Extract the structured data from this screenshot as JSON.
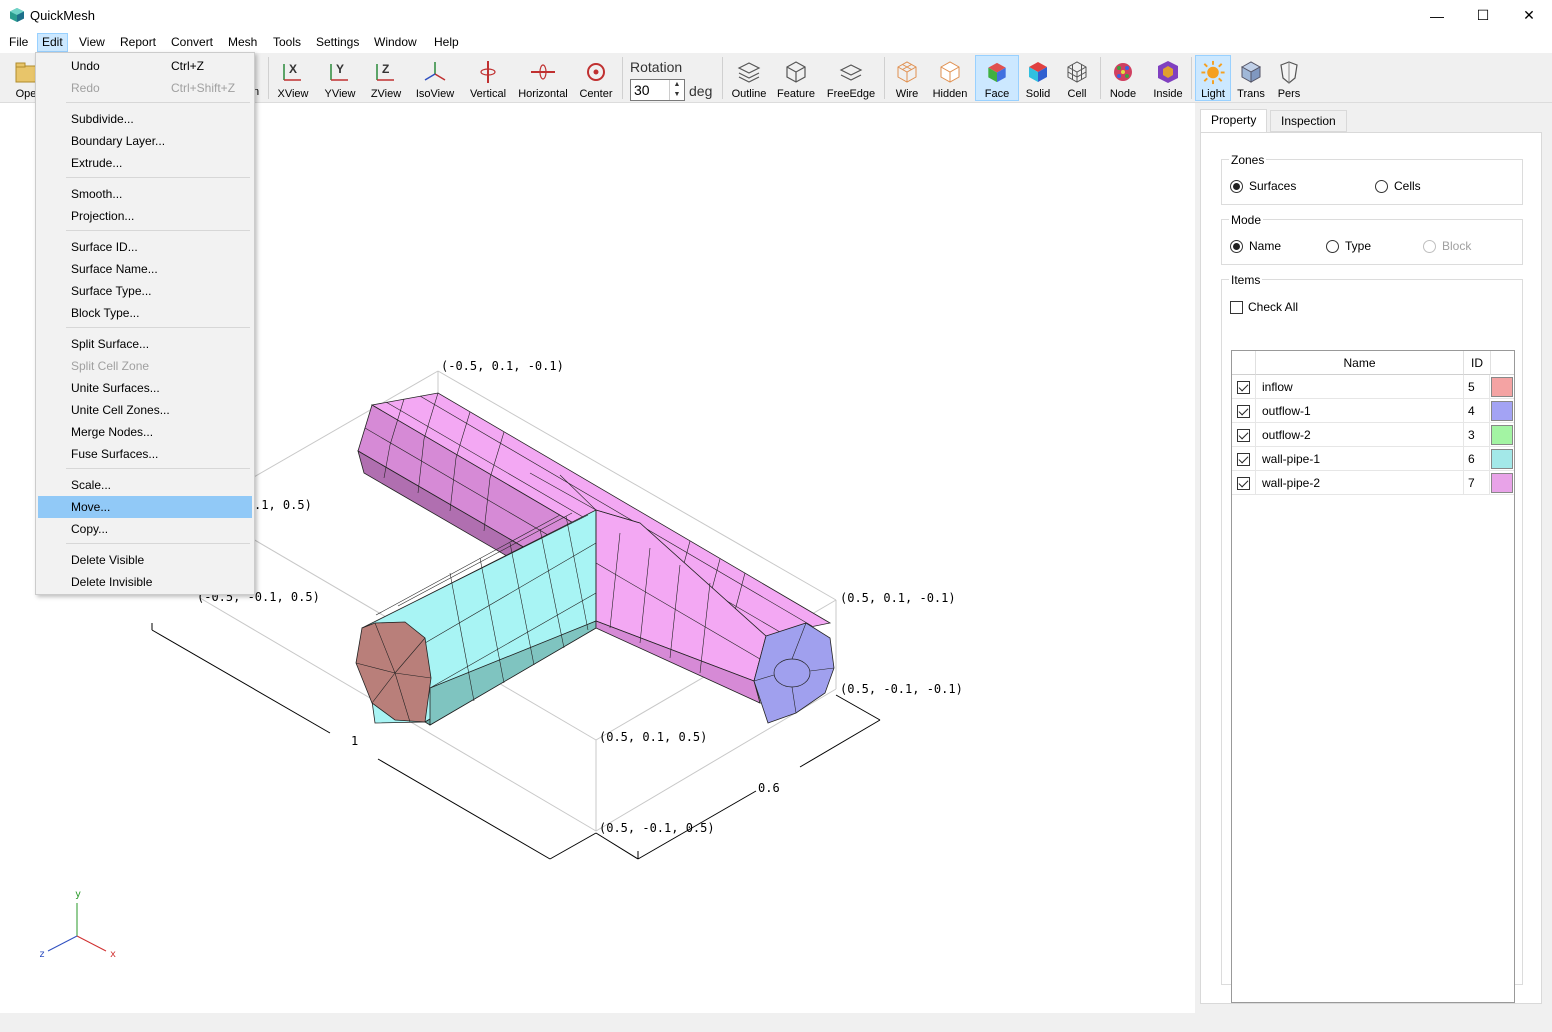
{
  "window": {
    "title": "QuickMesh",
    "minimize_glyph": "—",
    "maximize_glyph": "☐",
    "close_glyph": "✕"
  },
  "menubar": {
    "items": [
      "File",
      "Edit",
      "View",
      "Report",
      "Convert",
      "Mesh",
      "Tools",
      "Settings",
      "Window",
      "Help"
    ],
    "active": "Edit"
  },
  "toolbar": {
    "open_label": "Ope",
    "partial_label": "n",
    "buttons": [
      {
        "label": "XView",
        "icon": "xview-icon"
      },
      {
        "label": "YView",
        "icon": "yview-icon"
      },
      {
        "label": "ZView",
        "icon": "zview-icon"
      },
      {
        "label": "IsoView",
        "icon": "isoview-icon"
      },
      {
        "label": "Vertical",
        "icon": "vertical-rotate-icon"
      },
      {
        "label": "Horizontal",
        "icon": "horizontal-rotate-icon"
      },
      {
        "label": "Center",
        "icon": "center-icon"
      },
      {
        "label": "Outline",
        "icon": "outline-icon"
      },
      {
        "label": "Feature",
        "icon": "feature-icon"
      },
      {
        "label": "FreeEdge",
        "icon": "freeedge-icon"
      },
      {
        "label": "Wire",
        "icon": "wire-icon"
      },
      {
        "label": "Hidden",
        "icon": "hidden-icon"
      },
      {
        "label": "Face",
        "icon": "face-icon",
        "checked": true
      },
      {
        "label": "Solid",
        "icon": "solid-icon"
      },
      {
        "label": "Cell",
        "icon": "cell-icon"
      },
      {
        "label": "Node",
        "icon": "node-icon"
      },
      {
        "label": "Inside",
        "icon": "inside-icon"
      },
      {
        "label": "Light",
        "icon": "light-icon",
        "checked": true
      },
      {
        "label": "Trans",
        "icon": "trans-icon"
      },
      {
        "label": "Pers",
        "icon": "pers-icon"
      }
    ],
    "rotation": {
      "label": "Rotation",
      "value": "30",
      "unit": "deg",
      "spin_up": "▲",
      "spin_down": "▼"
    }
  },
  "edit_menu": {
    "items": [
      {
        "label": "Undo",
        "shortcut": "Ctrl+Z"
      },
      {
        "label": "Redo",
        "shortcut": "Ctrl+Shift+Z",
        "disabled": true
      },
      {
        "sep": true
      },
      {
        "label": "Subdivide..."
      },
      {
        "label": "Boundary Layer..."
      },
      {
        "label": "Extrude..."
      },
      {
        "sep": true
      },
      {
        "label": "Smooth..."
      },
      {
        "label": "Projection..."
      },
      {
        "sep": true
      },
      {
        "label": "Surface ID..."
      },
      {
        "label": "Surface Name..."
      },
      {
        "label": "Surface Type..."
      },
      {
        "label": "Block Type..."
      },
      {
        "sep": true
      },
      {
        "label": "Split Surface..."
      },
      {
        "label": "Split Cell Zone",
        "disabled": true
      },
      {
        "label": "Unite Surfaces..."
      },
      {
        "label": "Unite Cell Zones..."
      },
      {
        "label": "Merge Nodes..."
      },
      {
        "label": "Fuse Surfaces..."
      },
      {
        "sep": true
      },
      {
        "label": "Scale..."
      },
      {
        "label": "Move...",
        "hover": true
      },
      {
        "label": "Copy..."
      },
      {
        "sep": true
      },
      {
        "label": "Delete Visible"
      },
      {
        "label": "Delete Invisible"
      }
    ]
  },
  "viewport": {
    "labels": {
      "c1": "(-0.5, 0.1, -0.1)",
      "c2": ".1, 0.5)",
      "c3": "(-0.5, -0.1, 0.5)",
      "c4": "(0.5, 0.1, -0.1)",
      "c5": "(0.5, -0.1, -0.1)",
      "c6": "(0.5, 0.1, 0.5)",
      "c7": "(0.5, -0.1, 0.5)",
      "dim_x": "1",
      "dim_z": "0.6"
    },
    "axes": {
      "x": "x",
      "y": "y",
      "z": "z"
    },
    "colors": {
      "inflow": "#b97f7a",
      "outflow1": "#a0a0ee",
      "pipe1": "#a8f4f4",
      "pipe2": "#f3a8f3"
    }
  },
  "panel": {
    "tabs": [
      "Property",
      "Inspection"
    ],
    "active_tab": "Property",
    "zones": {
      "title": "Zones",
      "options": [
        "Surfaces",
        "Cells"
      ],
      "selected": "Surfaces"
    },
    "mode": {
      "title": "Mode",
      "options": [
        "Name",
        "Type",
        "Block"
      ],
      "selected": "Name",
      "disabled": "Block"
    },
    "items": {
      "title": "Items",
      "check_all": "Check All",
      "columns": [
        "Name",
        "ID"
      ],
      "rows": [
        {
          "name": "inflow",
          "id": "5",
          "color": "#f4a3a3",
          "checked": true
        },
        {
          "name": "outflow-1",
          "id": "4",
          "color": "#a3a3f4",
          "checked": true
        },
        {
          "name": "outflow-2",
          "id": "3",
          "color": "#a3f4a3",
          "checked": true
        },
        {
          "name": "wall-pipe-1",
          "id": "6",
          "color": "#a3e8e8",
          "checked": true
        },
        {
          "name": "wall-pipe-2",
          "id": "7",
          "color": "#e8a3e8",
          "checked": true
        }
      ]
    }
  }
}
